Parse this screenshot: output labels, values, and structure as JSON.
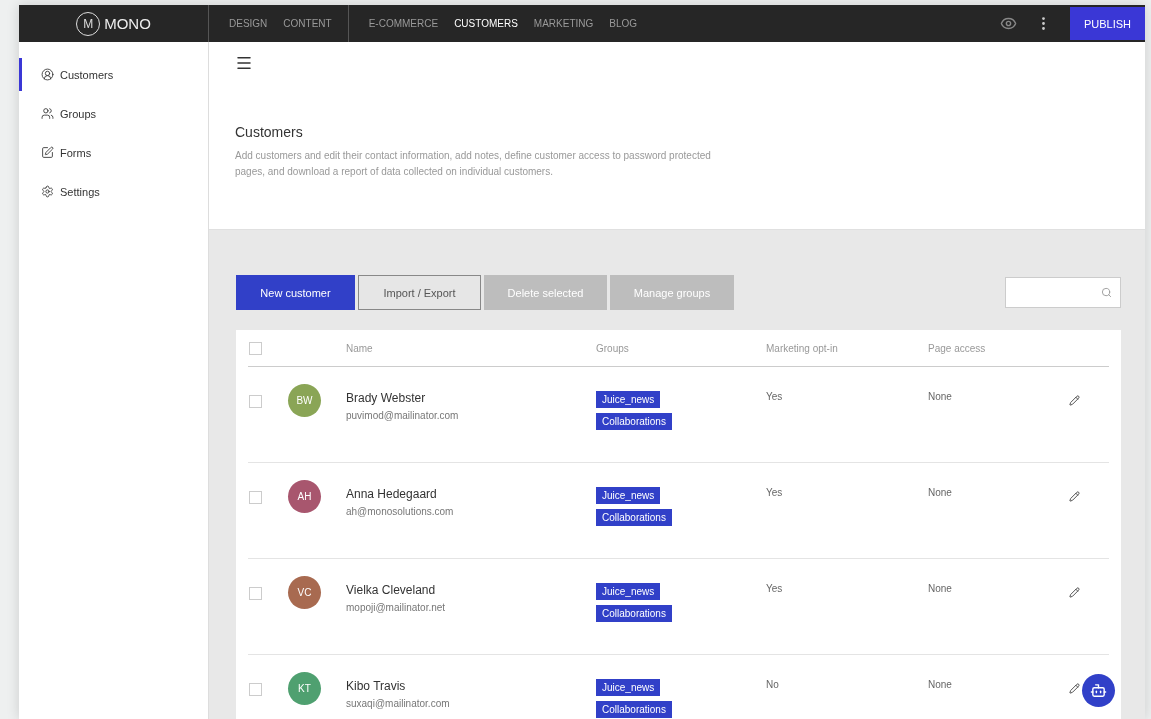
{
  "logo": {
    "mark": "M",
    "text": "MONO"
  },
  "nav_groups": [
    [
      {
        "label": "DESIGN",
        "selected": false
      },
      {
        "label": "CONTENT",
        "selected": false
      }
    ],
    [
      {
        "label": "E-COMMERCE",
        "selected": false
      },
      {
        "label": "CUSTOMERS",
        "selected": true
      },
      {
        "label": "MARKETING",
        "selected": false
      },
      {
        "label": "BLOG",
        "selected": false
      }
    ]
  ],
  "publish": "PUBLISH",
  "sidebar": {
    "items": [
      {
        "label": "Customers",
        "kind": "user",
        "selected": true
      },
      {
        "label": "Groups",
        "kind": "group",
        "selected": false
      },
      {
        "label": "Forms",
        "kind": "form",
        "selected": false
      },
      {
        "label": "Settings",
        "kind": "gear",
        "selected": false
      }
    ]
  },
  "header": {
    "title": "Customers",
    "description": "Add customers and edit their contact information, add notes, define customer access to password protected pages, and download a report of data collected on individual customers."
  },
  "toolbar": {
    "buttons": [
      {
        "label": "New customer",
        "kind": "primary",
        "disabled": false
      },
      {
        "label": "Import / Export",
        "kind": "outline",
        "disabled": false
      },
      {
        "label": "Delete selected",
        "kind": "plain",
        "disabled": true
      },
      {
        "label": "Manage groups",
        "kind": "plain",
        "disabled": true
      }
    ]
  },
  "table": {
    "select_all": false,
    "columns": [
      "Name",
      "Groups",
      "Marketing opt-in",
      "Page access"
    ],
    "rows": [
      {
        "checked": false,
        "initials": "BW",
        "color": "#8aa556",
        "name": "Brady Webster",
        "email": "puvimod@mailinator.com",
        "groups": [
          "Juice_news",
          "Collaborations"
        ],
        "marketing": "Yes",
        "access": "None"
      },
      {
        "checked": false,
        "initials": "AH",
        "color": "#a8566e",
        "name": "Anna Hedegaard",
        "email": "ah@monosolutions.com",
        "groups": [
          "Juice_news",
          "Collaborations"
        ],
        "marketing": "Yes",
        "access": "None"
      },
      {
        "checked": false,
        "initials": "VC",
        "color": "#a86a50",
        "name": "Vielka Cleveland",
        "email": "mopoji@mailinator.net",
        "groups": [
          "Juice_news",
          "Collaborations"
        ],
        "marketing": "Yes",
        "access": "None"
      },
      {
        "checked": false,
        "initials": "KT",
        "color": "#4fa070",
        "name": "Kibo Travis",
        "email": "suxaqi@mailinator.com",
        "groups": [
          "Juice_news",
          "Collaborations"
        ],
        "marketing": "No",
        "access": "None"
      }
    ]
  }
}
